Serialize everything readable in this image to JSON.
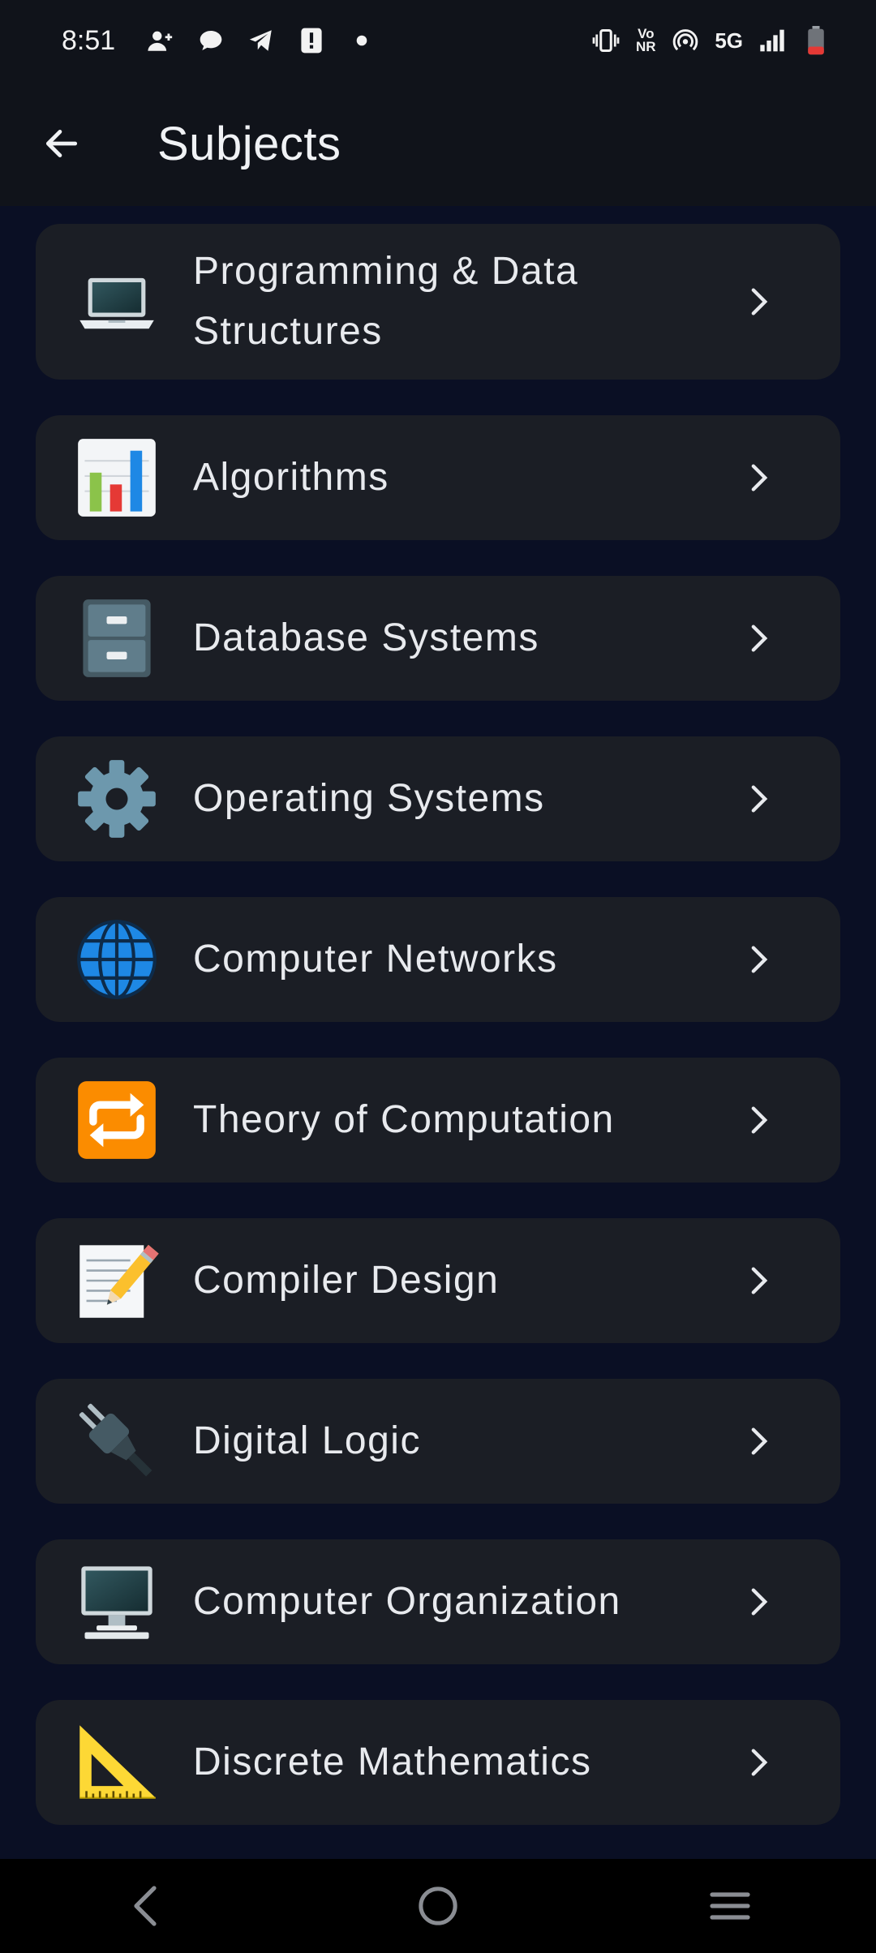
{
  "status_bar": {
    "time": "8:51",
    "network": "5G",
    "volte": "Vo NR",
    "icons": [
      "add-contact-icon",
      "chat-bubble-icon",
      "telegram-icon",
      "alert-icon",
      "dot-icon",
      "vibrate-icon",
      "hotspot-icon",
      "signal-icon",
      "battery-low-icon"
    ]
  },
  "app_bar": {
    "title": "Subjects",
    "back_icon": "arrow-left-icon"
  },
  "subjects": [
    {
      "label": "Programming & Data Structures",
      "icon": "laptop-icon"
    },
    {
      "label": "Algorithms",
      "icon": "bar-chart-icon"
    },
    {
      "label": "Database Systems",
      "icon": "file-cabinet-icon"
    },
    {
      "label": "Operating Systems",
      "icon": "gear-icon"
    },
    {
      "label": "Computer Networks",
      "icon": "globe-icon"
    },
    {
      "label": "Theory of Computation",
      "icon": "repeat-icon"
    },
    {
      "label": "Compiler Design",
      "icon": "memo-icon"
    },
    {
      "label": "Digital Logic",
      "icon": "plug-icon"
    },
    {
      "label": "Computer Organization",
      "icon": "desktop-computer-icon"
    },
    {
      "label": "Discrete Mathematics",
      "icon": "triangle-ruler-icon"
    }
  ],
  "colors": {
    "background": "#0a0f24",
    "card": "#1b1e25",
    "bar": "#10131a",
    "text": "#e8eaee",
    "battery_low": "#e53935"
  },
  "nav_bar": {
    "icons": [
      "nav-back-icon",
      "nav-home-icon",
      "nav-recents-icon"
    ]
  }
}
